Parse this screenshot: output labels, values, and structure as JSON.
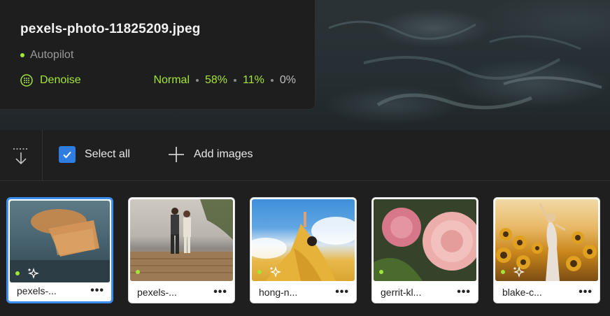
{
  "info": {
    "filename": "pexels-photo-11825209.jpeg",
    "mode": "Autopilot",
    "enhancement": {
      "name": "Denoise",
      "level": "Normal",
      "values": [
        "58%",
        "11%",
        "0%"
      ]
    }
  },
  "toolbar": {
    "select_all_label": "Select all",
    "select_all_checked": true,
    "add_images_label": "Add images"
  },
  "thumbnails": [
    {
      "label": "pexels-...",
      "selected": true,
      "enhanced": true
    },
    {
      "label": "pexels-...",
      "selected": false,
      "enhanced": false
    },
    {
      "label": "hong-n...",
      "selected": false,
      "enhanced": true
    },
    {
      "label": "gerrit-kl...",
      "selected": false,
      "enhanced": false
    },
    {
      "label": "blake-c...",
      "selected": false,
      "enhanced": true
    }
  ],
  "more_label": "•••",
  "colors": {
    "accent_green": "#a3e635",
    "select_blue": "#3b8ef0"
  }
}
